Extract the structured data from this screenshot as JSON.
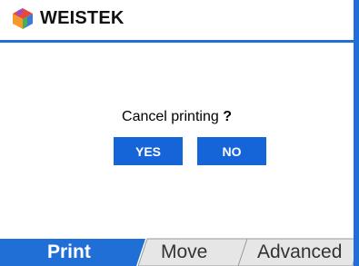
{
  "header": {
    "brand": "WEISTEK",
    "logo_icon": "cube-logo-icon"
  },
  "dialog": {
    "message": "Cancel printing",
    "question_mark": "?",
    "yes_label": "YES",
    "no_label": "NO"
  },
  "tabs": [
    {
      "label": "Print",
      "active": true
    },
    {
      "label": "Move",
      "active": false
    },
    {
      "label": "Advanced",
      "active": false
    }
  ],
  "colors": {
    "accent": "#1f6fd6",
    "button": "#1565d8",
    "tab_inactive": "#e8e8e8"
  }
}
